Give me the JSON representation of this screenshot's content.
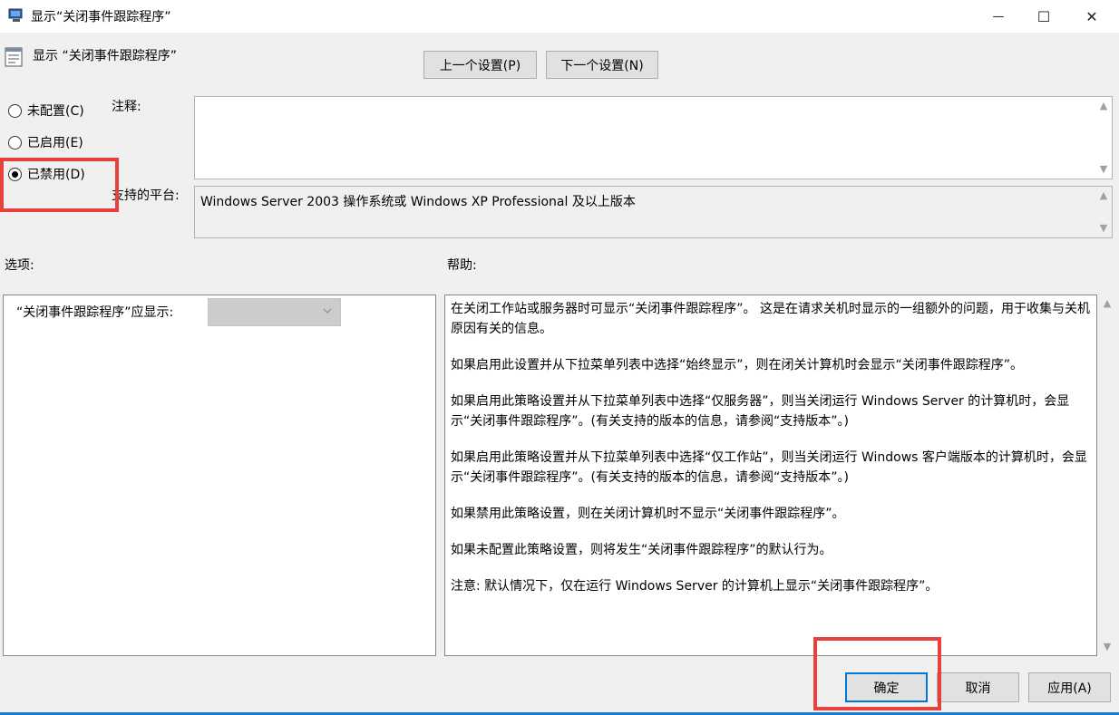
{
  "window": {
    "title": "显示“关闭事件跟踪程序”",
    "minimize_glyph": "—",
    "maximize_glyph": "☐",
    "close_glyph": "✕"
  },
  "header": {
    "policy_title": "显示 “关闭事件跟踪程序”",
    "prev_button": "上一个设置(P)",
    "next_button": "下一个设置(N)"
  },
  "state_options": [
    {
      "label": "未配置(C)",
      "checked": false
    },
    {
      "label": "已启用(E)",
      "checked": false
    },
    {
      "label": "已禁用(D)",
      "checked": true
    }
  ],
  "comment": {
    "label": "注释:",
    "value": ""
  },
  "platform": {
    "label": "支持的平台:",
    "value": "Windows Server 2003 操作系统或 Windows XP Professional 及以上版本"
  },
  "options": {
    "header": "选项:",
    "field_label": "“关闭事件跟踪程序”应显示:",
    "select_value": ""
  },
  "help": {
    "header": "帮助:",
    "paragraphs": [
      "在关闭工作站或服务器时可显示“关闭事件跟踪程序”。 这是在请求关机时显示的一组额外的问题，用于收集与关机原因有关的信息。",
      "如果启用此设置并从下拉菜单列表中选择“始终显示”，则在闭关计算机时会显示“关闭事件跟踪程序”。",
      "如果启用此策略设置并从下拉菜单列表中选择“仅服务器”，则当关闭运行 Windows Server 的计算机时，会显示“关闭事件跟踪程序”。(有关支持的版本的信息，请参阅“支持版本”。)",
      "如果启用此策略设置并从下拉菜单列表中选择“仅工作站”，则当关闭运行 Windows 客户端版本的计算机时，会显示“关闭事件跟踪程序”。(有关支持的版本的信息，请参阅“支持版本”。)",
      "如果禁用此策略设置，则在关闭计算机时不显示“关闭事件跟踪程序”。",
      "如果未配置此策略设置，则将发生“关闭事件跟踪程序”的默认行为。",
      "注意: 默认情况下，仅在运行 Windows Server 的计算机上显示“关闭事件跟踪程序”。"
    ]
  },
  "footer": {
    "ok_button": "确定",
    "cancel_button": "取消",
    "apply_button": "应用(A)"
  },
  "colors": {
    "highlight": "#e8413c",
    "focus_border": "#0078d7",
    "window_bg": "#f0f0f0"
  }
}
